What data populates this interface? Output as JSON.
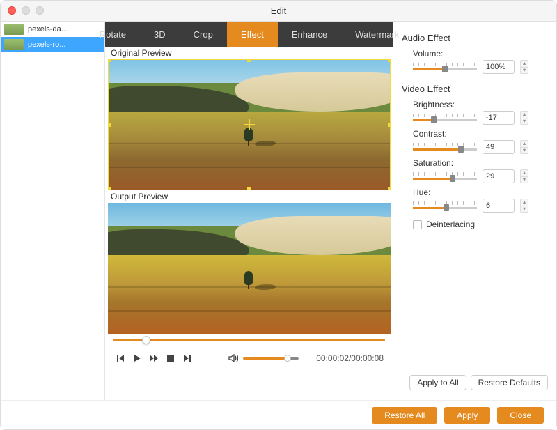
{
  "window": {
    "title": "Edit"
  },
  "sidebar": {
    "items": [
      {
        "label": "pexels-da..."
      },
      {
        "label": "pexels-ro..."
      }
    ],
    "selected_index": 1
  },
  "tabs": {
    "items": [
      "Rotate",
      "3D",
      "Crop",
      "Effect",
      "Enhance",
      "Watermark"
    ],
    "active_index": 3
  },
  "preview": {
    "original_label": "Original Preview",
    "output_label": "Output Preview"
  },
  "playback": {
    "position_pct": 12,
    "volume_pct": 80,
    "time_current": "00:00:02",
    "time_total": "00:00:08"
  },
  "audio_effect": {
    "title": "Audio Effect",
    "volume_label": "Volume:",
    "volume_value": "100%",
    "volume_pct": 50
  },
  "video_effect": {
    "title": "Video Effect",
    "brightness_label": "Brightness:",
    "brightness_value": "-17",
    "brightness_pct": 33,
    "contrast_label": "Contrast:",
    "contrast_value": "49",
    "contrast_pct": 75,
    "saturation_label": "Saturation:",
    "saturation_value": "29",
    "saturation_pct": 62,
    "hue_label": "Hue:",
    "hue_value": "6",
    "hue_pct": 52,
    "deinterlacing_label": "Deinterlacing",
    "deinterlacing_checked": false
  },
  "panel_buttons": {
    "apply_all": "Apply to All",
    "restore_defaults": "Restore Defaults"
  },
  "footer": {
    "restore_all": "Restore All",
    "apply": "Apply",
    "close": "Close"
  }
}
